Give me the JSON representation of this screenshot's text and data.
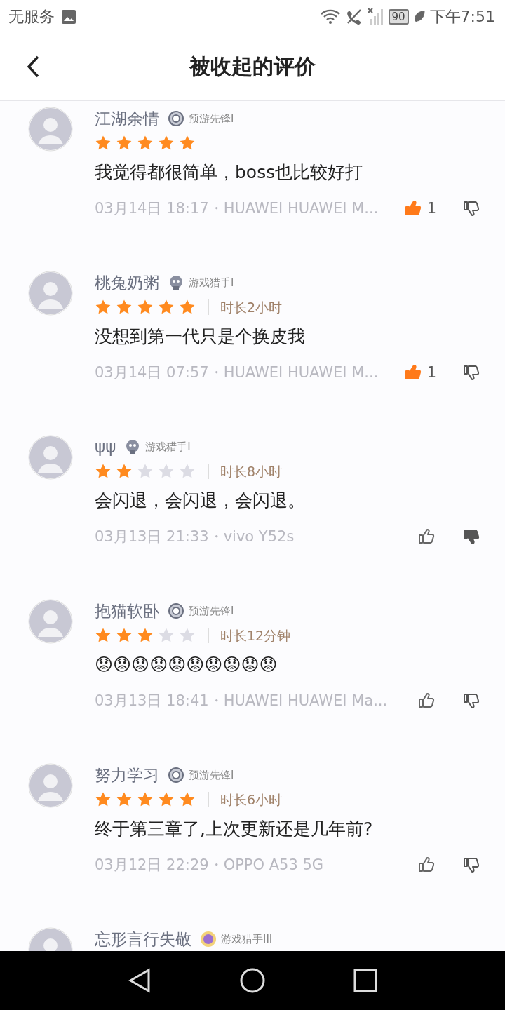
{
  "status_bar": {
    "carrier": "无服务",
    "battery": "90",
    "time": "下午7:51"
  },
  "header": {
    "title": "被收起的评价"
  },
  "reviews": [
    {
      "name": "江湖余情",
      "badge": {
        "label": "预游先锋I",
        "kind": "vanguard"
      },
      "stars": 5,
      "text": "我觉得都很简单，boss也比较好打",
      "meta": "03月14日 18:17・HUAWEI HUAWEI M...",
      "likes": "1",
      "liked": true,
      "disliked": false
    },
    {
      "name": "桃兔奶粥",
      "badge": {
        "label": "游戏猎手I",
        "kind": "hunter"
      },
      "stars": 5,
      "playtime": "时长2小时",
      "text": "没想到第一代只是个换皮我",
      "meta": "03月14日 07:57・HUAWEI HUAWEI M...",
      "likes": "1",
      "liked": true,
      "disliked": false
    },
    {
      "name": "ψψ",
      "badge": {
        "label": "游戏猎手I",
        "kind": "hunter"
      },
      "stars": 2,
      "playtime": "时长8小时",
      "text": "会闪退，会闪退，会闪退。",
      "meta": "03月13日 21:33・vivo Y52s",
      "liked": false,
      "disliked": true
    },
    {
      "name": "抱猫软卧",
      "badge": {
        "label": "预游先锋I",
        "kind": "vanguard"
      },
      "stars": 3,
      "playtime": "时长12分钟",
      "text": "😟😟😟😟😟😟😟😟😟😟",
      "meta": "03月13日 18:41・HUAWEI HUAWEI Ma...",
      "liked": false,
      "disliked": false
    },
    {
      "name": "努力学习",
      "badge": {
        "label": "预游先锋I",
        "kind": "vanguard"
      },
      "stars": 5,
      "playtime": "时长6小时",
      "text": "终于第三章了,上次更新还是几年前?",
      "meta": "03月12日 22:29・OPPO A53 5G",
      "liked": false,
      "disliked": false
    },
    {
      "name": "忘形言行失敬",
      "badge": {
        "label": "游戏猎手III",
        "kind": "hunter_gold"
      }
    }
  ]
}
